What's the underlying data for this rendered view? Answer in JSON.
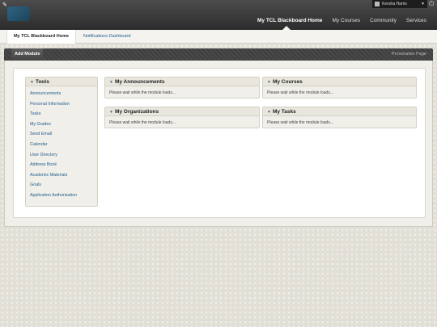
{
  "header": {
    "user_name": "Kendra Harris",
    "nav": [
      {
        "label": "My TCL Blackboard Home",
        "active": true
      },
      {
        "label": "My Courses",
        "active": false
      },
      {
        "label": "Community",
        "active": false
      },
      {
        "label": "Services",
        "active": false
      }
    ]
  },
  "subtabs": {
    "active": "My TCL Blackboard Home",
    "link": "Notifications Dashboard"
  },
  "actionbar": {
    "add_module": "Add Module",
    "personalize": "Personalize Page"
  },
  "tools": {
    "title": "Tools",
    "items": [
      "Announcements",
      "Personal Information",
      "Tasks",
      "My Grades",
      "Send Email",
      "Calendar",
      "User Directory",
      "Address Book",
      "Academic Materials",
      "Goals",
      "Application Authorization"
    ]
  },
  "modules": [
    {
      "title": "My Announcements",
      "body": "Please wait while the module loads..."
    },
    {
      "title": "My Courses",
      "body": "Please wait while the module loads..."
    },
    {
      "title": "My Organizations",
      "body": "Please wait while the module loads..."
    },
    {
      "title": "My Tasks",
      "body": "Please wait while the module loads..."
    }
  ],
  "icons": {
    "logo": "tcl-logo-icon",
    "user": "user-avatar-icon",
    "caret": "caret-down-icon",
    "power": "power-icon",
    "collapse": "triangle-down-icon"
  },
  "colors": {
    "header": "#3a3a3a",
    "link": "#1f5e8e",
    "background": "#e2dfd7"
  }
}
